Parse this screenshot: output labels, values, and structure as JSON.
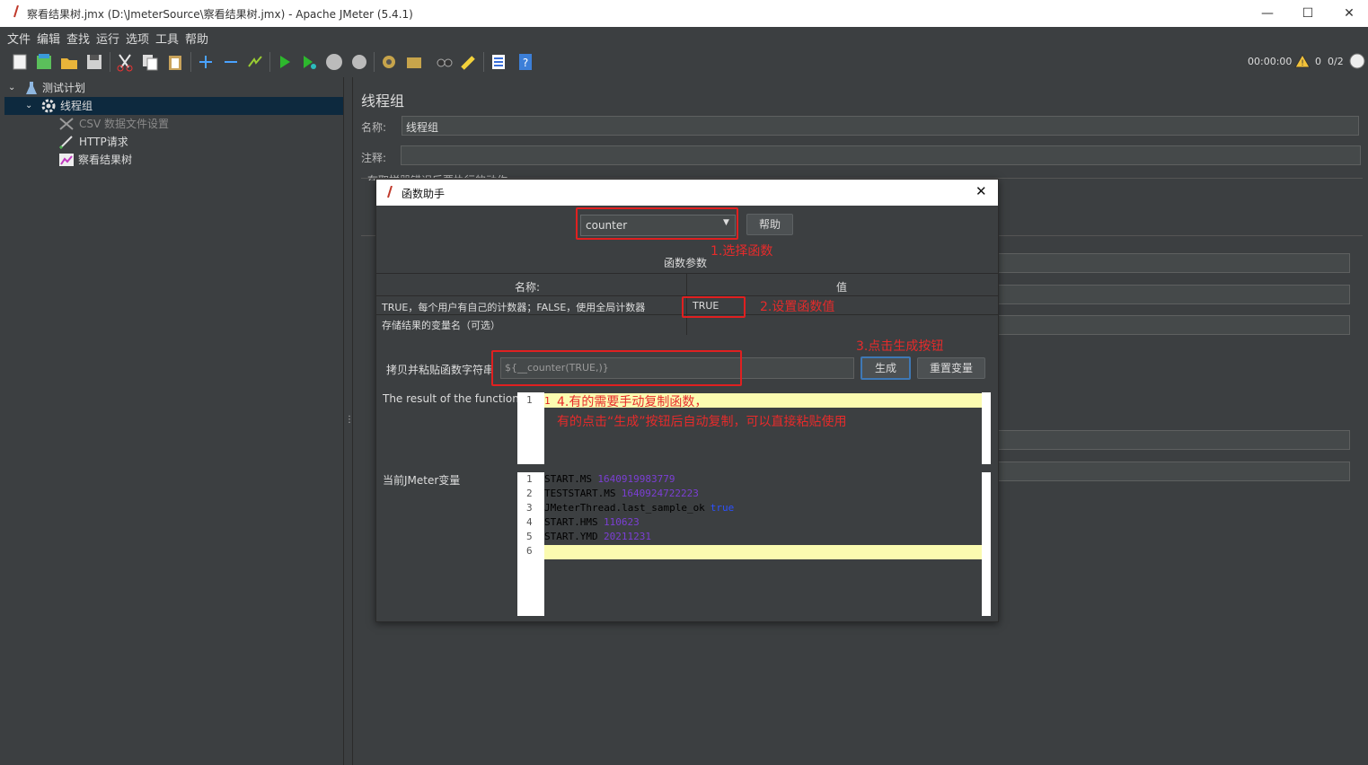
{
  "window": {
    "title": "察看结果树.jmx (D:\\JmeterSource\\察看结果树.jmx) - Apache JMeter (5.4.1)",
    "minimize": "—",
    "maximize": "☐",
    "close": "✕"
  },
  "menu": [
    "文件",
    "编辑",
    "查找",
    "运行",
    "选项",
    "工具",
    "帮助"
  ],
  "status": {
    "time": "00:00:00",
    "warnings": "0",
    "threads": "0/2"
  },
  "tree": {
    "items": [
      {
        "label": "测试计划",
        "icon": "flask-icon"
      },
      {
        "label": "线程组",
        "icon": "gear-icon"
      },
      {
        "label": "CSV 数据文件设置",
        "icon": "tools-icon"
      },
      {
        "label": "HTTP请求",
        "icon": "pen-icon"
      },
      {
        "label": "察看结果树",
        "icon": "chart-icon"
      }
    ]
  },
  "panel": {
    "heading": "线程组",
    "name_label": "名称:",
    "name_value": "线程组",
    "comment_label": "注释:",
    "error_action_partial": "在取样器错误后要执行的动作"
  },
  "dialog": {
    "title": "函数助手",
    "function_value": "counter",
    "help_button": "帮助",
    "params_label": "函数参数",
    "table": {
      "headers": [
        "名称:",
        "值"
      ],
      "rows": [
        {
          "name": "TRUE，每个用户有自己的计数器；FALSE，使用全局计数器",
          "value": "TRUE"
        },
        {
          "name": "存储结果的变量名（可选）",
          "value": ""
        }
      ]
    },
    "copy_label": "拷贝并粘贴函数字符串",
    "function_string": "${__counter(TRUE,)}",
    "generate_button": "生成",
    "reset_button": "重置变量",
    "result_label": "The result of the function is",
    "result_line_no": "1",
    "result_text": "1",
    "vars_label": "当前JMeter变量",
    "vars": [
      {
        "no": "1",
        "key": "START.MS",
        "val": "1640919983779",
        "kind": "num"
      },
      {
        "no": "2",
        "key": "TESTSTART.MS",
        "val": "1640924722223",
        "kind": "num"
      },
      {
        "no": "3",
        "key": "JMeterThread.last_sample_ok",
        "val": "true",
        "kind": "bool"
      },
      {
        "no": "4",
        "key": "START.HMS",
        "val": "110623",
        "kind": "num"
      },
      {
        "no": "5",
        "key": "START.YMD",
        "val": "20211231",
        "kind": "num"
      },
      {
        "no": "6",
        "key": "",
        "val": "",
        "kind": "none"
      }
    ]
  },
  "annotations": {
    "step1": "1.选择函数",
    "step2": "2.设置函数值",
    "step3": "3.点击生成按钮",
    "step4a": "4.有的需要手动复制函数，",
    "step4b": "有的点击“生成”按钮后自动复制，可以直接粘贴使用"
  },
  "colors": {
    "accent_red": "#e02020",
    "var_num": "#7b3fd4",
    "var_bool": "#2b50ff",
    "highlight": "#fbfbb0"
  }
}
